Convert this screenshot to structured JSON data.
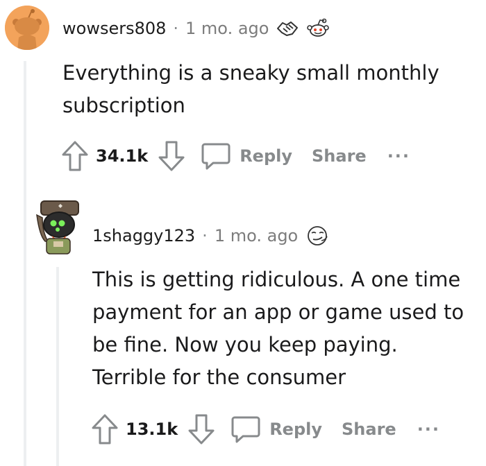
{
  "comments": [
    {
      "username": "wowsers808",
      "separator": "·",
      "time": "1 mo. ago",
      "body": "Everything is a sneaky small monthly subscription",
      "votes": "34.1k",
      "reply_label": "Reply",
      "share_label": "Share",
      "more_label": "···"
    },
    {
      "username": "1shaggy123",
      "separator": "·",
      "time": "1 mo. ago",
      "body": "This is getting ridiculous. A one time payment for an app or game used to be fine. Now you keep paying. Terrible for the consumer",
      "votes": "13.1k",
      "reply_label": "Reply",
      "share_label": "Share",
      "more_label": "···"
    }
  ],
  "colors": {
    "avatar_orange": "#f3a35b",
    "muted": "#878a8c",
    "thread_line": "#edeff1"
  }
}
